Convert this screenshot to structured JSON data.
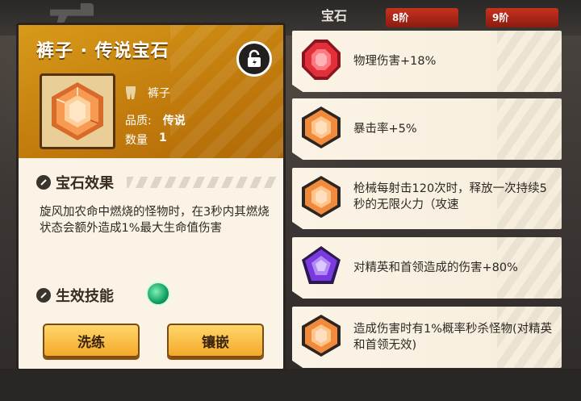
{
  "background": {
    "tab_label": "宝石",
    "badges": [
      "8阶",
      "9阶"
    ]
  },
  "detail": {
    "title": "裤子 · 传说宝石",
    "category": "裤子",
    "quality_label": "品质:",
    "quality_value": "传说",
    "quantity_label": "数量",
    "quantity_value": "1",
    "effect_heading": "宝石效果",
    "effect_text": "旋风加农命中燃烧的怪物时，在3秒内其燃烧状态会额外造成1%最大生命值伤害",
    "skill_heading": "生效技能",
    "buttons": {
      "refine": "洗练",
      "inlay": "镶嵌"
    }
  },
  "gems": [
    {
      "icon": "red-gem-icon",
      "color": "#e2303a",
      "text": "物理伤害+18%"
    },
    {
      "icon": "orange-gem-icon",
      "color": "#f08a3c",
      "text": "暴击率+5%"
    },
    {
      "icon": "orange-gem-icon",
      "color": "#f08a3c",
      "text": "枪械每射击120次时，释放一次持续5秒的无限火力（攻速"
    },
    {
      "icon": "purple-gem-icon",
      "color": "#7a3ae0",
      "text": "对精英和首领造成的伤害+80%"
    },
    {
      "icon": "orange-gem-icon",
      "color": "#f08a3c",
      "text": "造成伤害时有1%概率秒杀怪物(对精英和首领无效)"
    }
  ]
}
